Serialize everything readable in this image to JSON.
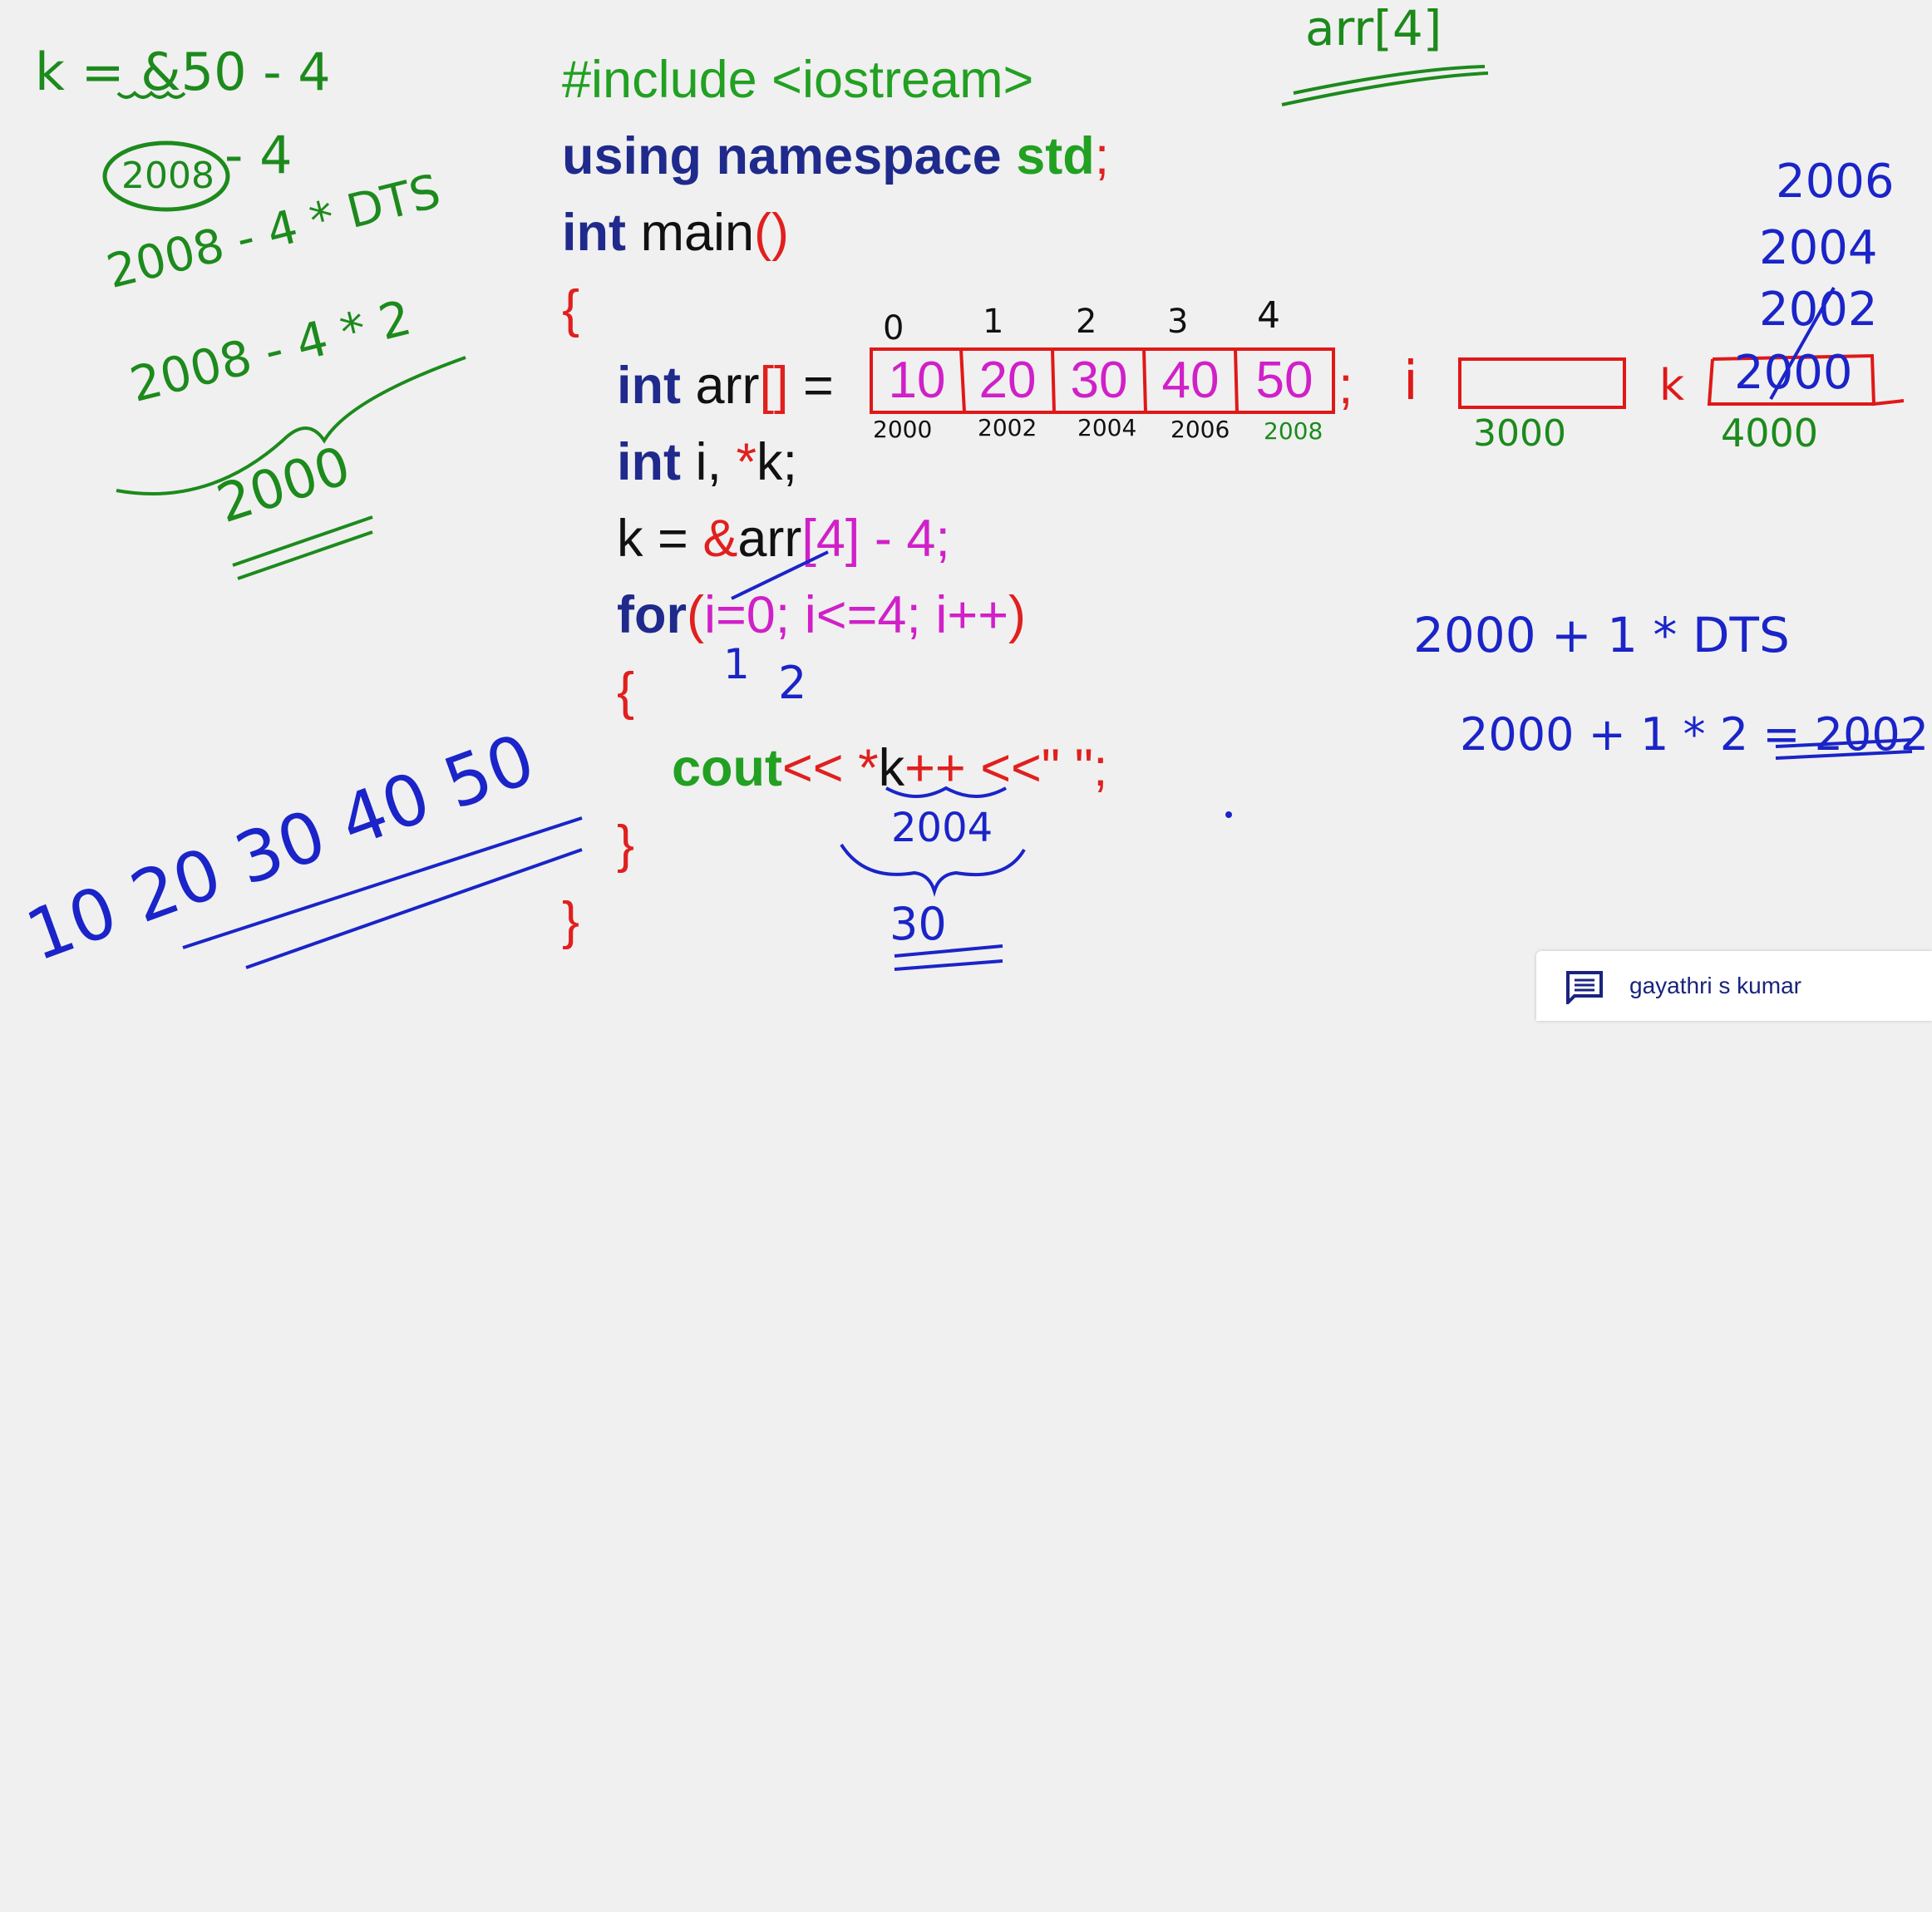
{
  "code": {
    "include_line": "#include <iostream>",
    "using_kw": "using namespace",
    "using_std": "std",
    "using_semi": ";",
    "main_kw": "int",
    "main_name": " main",
    "main_parens": "()",
    "open_brace": "{",
    "arr_kw": "int",
    "arr_decl": " arr",
    "arr_brackets": "[]",
    "arr_assign": " = ",
    "arr_semi": ";",
    "ivars_kw": "int",
    "ivars_i": " i, ",
    "ivars_star": "*",
    "ivars_k": "k;",
    "k_lhs": "k = ",
    "k_amp": "&",
    "k_arr": "arr",
    "k_rest": "[4] - 4;",
    "for_kw": "for",
    "for_paren": "(",
    "for_body": "i=0; i<=4; i++",
    "for_close": ")",
    "loop_open": "{",
    "cout_kw": "cout",
    "cout_op": "<< ",
    "cout_star": "*",
    "cout_k": "k",
    "cout_rest": "++ <<\" \";",
    "loop_close": "}",
    "close_brace": "}"
  },
  "array": {
    "values": [
      "10",
      "20",
      "30",
      "40",
      "50"
    ],
    "indices": [
      "0",
      "1",
      "2",
      "3",
      "4"
    ],
    "addresses": [
      "2000",
      "2002",
      "2004",
      "2006",
      "2008"
    ]
  },
  "annotations": {
    "top_arr": "arr[4]",
    "k_eq": "k = &50 - 4",
    "addr_2008": "2008",
    "minus4": "- 4",
    "dts_line": "2008 - 4 * DTS",
    "times2_line": "2008 - 4 * 2",
    "result_2000": "2000",
    "i_label": "i",
    "i_addr": "3000",
    "k_label": "k",
    "k_value": "2000",
    "k_addr": "4000",
    "k_stack": [
      "2006",
      "2004",
      "2002"
    ],
    "for_new_i": "2",
    "for_old_i": "1",
    "cout_addr": "2004",
    "cout_value": "30",
    "dts_calc": "2000 + 1 * DTS",
    "calc_result": "2000 + 1 * 2 = 2002",
    "output_values": "10 20 30 40 50"
  },
  "colors": {
    "board_bg": "#f0f0f0",
    "code_green": "#22a022",
    "code_navy": "#1f2a8c",
    "code_red": "#e0201e",
    "code_magenta": "#d020c8",
    "pen_green": "#1c8a1c",
    "pen_blue": "#1a24c8",
    "pen_red": "#e01818"
  },
  "chip": {
    "icon": "comment-icon",
    "name": "gayathri s kumar"
  }
}
